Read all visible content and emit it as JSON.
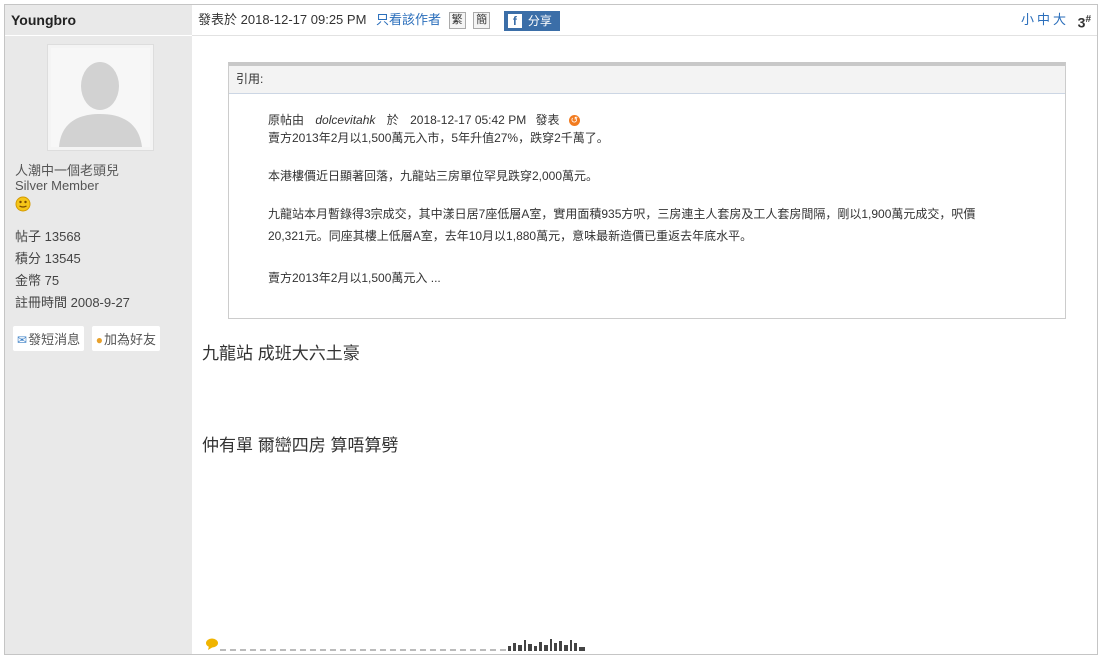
{
  "author": {
    "username": "Youngbro",
    "nickname": "人潮中一個老頭兒",
    "rank": "Silver Member",
    "stats": [
      {
        "label": "帖子",
        "value": "13568"
      },
      {
        "label": "積分",
        "value": "13545"
      },
      {
        "label": "金幣",
        "value": "75"
      },
      {
        "label": "註冊時間",
        "value": "2008-9-27"
      }
    ],
    "actions": {
      "pm": "發短消息",
      "friend": "加為好友"
    }
  },
  "post_header": {
    "posted_prefix": "發表於",
    "posted_time": "2018-12-17 09:25 PM",
    "only_author": "只看該作者",
    "trad_btn": "繁",
    "simp_btn": "簡",
    "share_label": "分享",
    "font_sizes": "小中大",
    "floor": "3",
    "floor_suffix": "#"
  },
  "quote": {
    "header": "引用:",
    "origin_prefix": "原帖由",
    "origin_author": "dolcevitahk",
    "origin_on": "於",
    "origin_time": "2018-12-17  05:42  PM",
    "origin_suffix": "發表",
    "lines": [
      "賣方2013年2月以1,500萬元入市，5年升值27%，跌穿2千萬了。",
      "本港樓價近日顯著回落，九龍站三房單位罕見跌穿2,000萬元。",
      "九龍站本月暫錄得3宗成交，其中漾日居7座低層A室，實用面積935方呎，三房連主人套房及工人套房間隔，剛以1,900萬元成交，呎價",
      "20,321元。同座其樓上低層A室，去年10月以1,880萬元，意味最新造價已重返去年底水平。",
      "賣方2013年2月以1,500萬元入  ..."
    ]
  },
  "content": {
    "line1": "九龍站  成班大六土豪",
    "line2": "仲有單  爾巒四房  算唔算劈"
  },
  "icons": {
    "avatar": "user-silhouette-icon",
    "medals": "smiley-medal-icon",
    "pm": "envelope-icon",
    "friend": "people-icon",
    "back": "back-arrow-icon",
    "signature": "speech-bubble-icon",
    "share": "facebook-icon"
  },
  "colors": {
    "link": "#2a6ebb",
    "sidebar_bg": "#e9e9e9",
    "facebook": "#3b6ea8"
  }
}
